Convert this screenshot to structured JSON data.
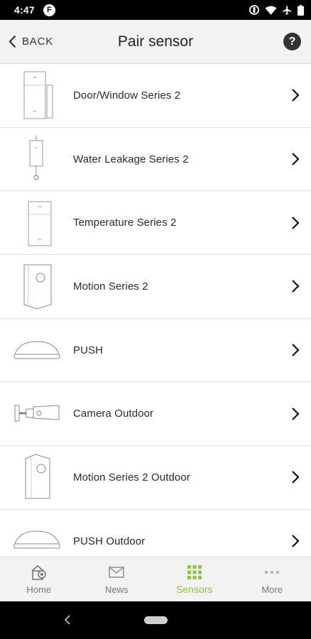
{
  "status_bar": {
    "time": "4:47",
    "app_badge": "F"
  },
  "header": {
    "back_label": "BACK",
    "title": "Pair sensor",
    "help_label": "?"
  },
  "sensors": [
    {
      "label": "Door/Window Series 2",
      "icon": "door-window-sensor-icon"
    },
    {
      "label": "Water Leakage Series 2",
      "icon": "water-leakage-sensor-icon"
    },
    {
      "label": "Temperature Series 2",
      "icon": "temperature-sensor-icon"
    },
    {
      "label": "Motion Series 2",
      "icon": "motion-sensor-icon"
    },
    {
      "label": "PUSH",
      "icon": "push-button-icon"
    },
    {
      "label": "Camera Outdoor",
      "icon": "camera-outdoor-icon"
    },
    {
      "label": "Motion Series 2 Outdoor",
      "icon": "motion-outdoor-sensor-icon"
    },
    {
      "label": "PUSH Outdoor",
      "icon": "push-outdoor-icon"
    }
  ],
  "bottom_nav": {
    "items": [
      {
        "label": "Home",
        "icon": "home-camera-icon",
        "active": false
      },
      {
        "label": "News",
        "icon": "envelope-icon",
        "active": false
      },
      {
        "label": "Sensors",
        "icon": "grid-icon",
        "active": true
      },
      {
        "label": "More",
        "icon": "dots-icon",
        "active": false
      }
    ],
    "active_color": "#8cc63f"
  },
  "colors": {
    "accent": "#8cc63f",
    "header_bg": "#f2f2f2",
    "status_bar_bg": "#000000"
  }
}
